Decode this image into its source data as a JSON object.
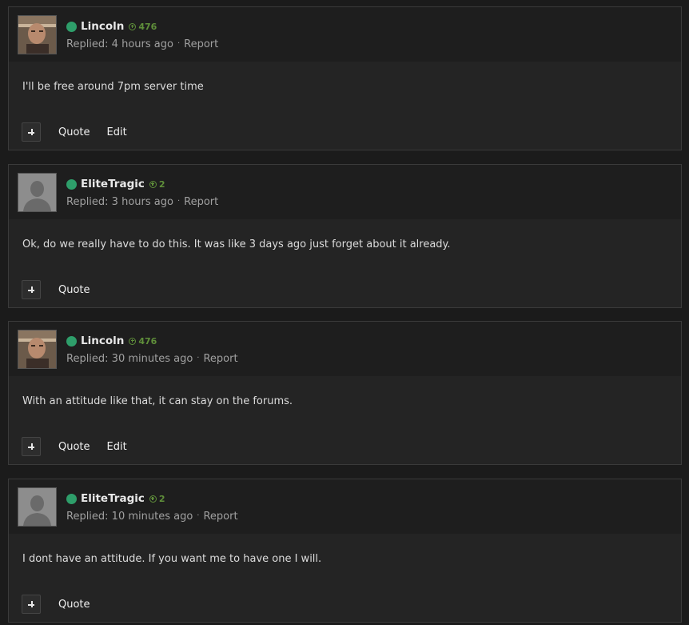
{
  "posts": [
    {
      "author": "Lincoln",
      "reputation": "476",
      "replied": "Replied: 4 hours ago",
      "report": "Report",
      "body": "I'll be free around 7pm server time",
      "quote": "Quote",
      "edit": "Edit",
      "avatar": "photo"
    },
    {
      "author": "EliteTragic",
      "reputation": "2",
      "replied": "Replied: 3 hours ago",
      "report": "Report",
      "body": "Ok, do we really have to do this. It was like 3 days ago just forget about it already.",
      "quote": "Quote",
      "avatar": "default"
    },
    {
      "author": "Lincoln",
      "reputation": "476",
      "replied": "Replied: 30 minutes ago",
      "report": "Report",
      "body": "With an attitude like that, it can stay on the forums.",
      "quote": "Quote",
      "edit": "Edit",
      "avatar": "photo"
    },
    {
      "author": "EliteTragic",
      "reputation": "2",
      "replied": "Replied: 10 minutes ago",
      "report": "Report",
      "body": "I dont have an attitude. If you want me to have one I will.",
      "quote": "Quote",
      "avatar": "default"
    }
  ],
  "separator": "·",
  "colors": {
    "online": "#2e9e6a",
    "reputation": "#5f8f3a",
    "post_bg": "#242424",
    "header_bg": "#1e1e1e"
  }
}
